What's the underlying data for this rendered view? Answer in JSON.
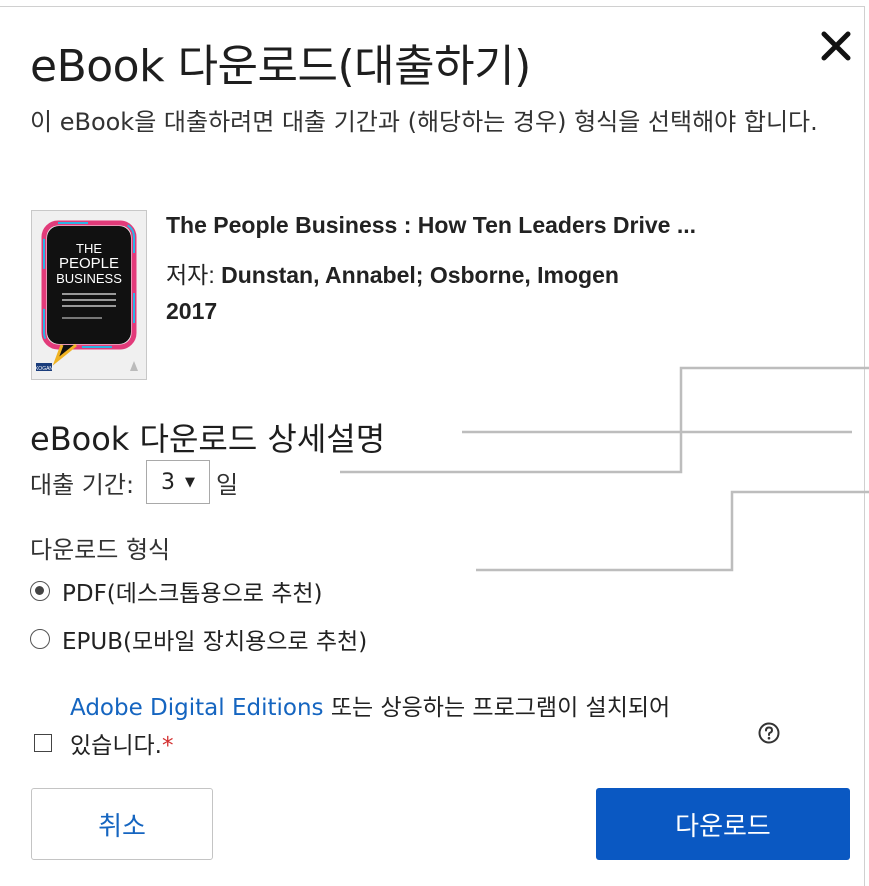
{
  "dialog": {
    "title": "eBook 다운로드(대출하기)",
    "close_icon": "close-icon",
    "intro": "이 eBook을 대출하려면 대출 기간과 (해당하는 경우) 형식을 선택해야 합니다."
  },
  "book": {
    "cover": {
      "line1": "THE",
      "line2": "PEOPLE",
      "line3": "BUSINESS",
      "publisher": "KOGAN"
    },
    "title": "The People Business : How Ten Leaders Drive ...",
    "author_label": "저자: ",
    "authors": "Dunstan, Annabel; Osborne, Imogen",
    "year": "2017"
  },
  "details": {
    "heading": "eBook 다운로드 상세설명",
    "loan_label": "대출 기간: ",
    "loan_value": "3",
    "loan_unit": "일",
    "format_label": "다운로드 형식",
    "formats": [
      {
        "label": "PDF(데스크톱용으로 추천)",
        "selected": true
      },
      {
        "label": "EPUB(모바일 장치용으로 추천)",
        "selected": false
      }
    ]
  },
  "ade": {
    "link": "Adobe Digital Editions",
    "text1": " 또는 상응하는 프로그램이 설치되어",
    "text2": "있습니다.",
    "required": "*",
    "checked": false
  },
  "buttons": {
    "cancel": "취소",
    "download": "다운로드"
  },
  "colors": {
    "primary": "#0a58c2",
    "link": "#1565c0",
    "required": "#d32f2f"
  }
}
